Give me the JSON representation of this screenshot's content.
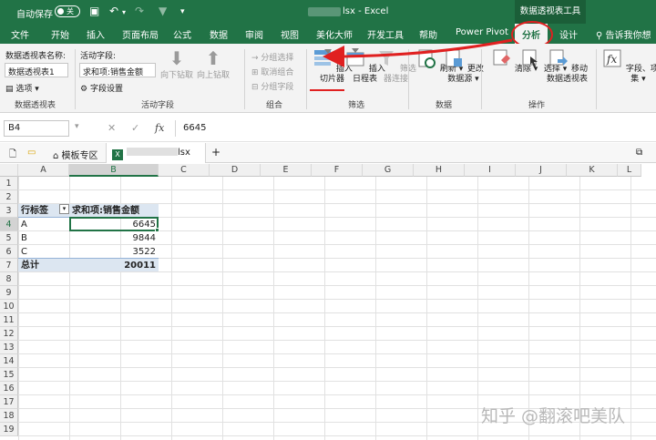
{
  "titlebar": {
    "autosave_label": "自动保存",
    "autosave_state": "关",
    "doc_title": "lsx  -  Excel",
    "context_tool": "数据透视表工具"
  },
  "tabs": [
    "文件",
    "开始",
    "插入",
    "页面布局",
    "公式",
    "数据",
    "审阅",
    "视图",
    "美化大师",
    "开发工具",
    "帮助",
    "Power Pivot",
    "分析",
    "设计"
  ],
  "tell_me": "告诉我你想",
  "ribbon": {
    "pivot_name_label": "数据透视表名称:",
    "pivot_name_value": "数据透视表1",
    "options_label": "选项",
    "active_field_label": "活动字段:",
    "active_field_value": "求和项:销售金额",
    "field_settings_label": "字段设置",
    "drill_down_label": "向下钻取",
    "drill_up_label": "向上钻取",
    "group_selection_label": "分组选择",
    "ungroup_label": "取消组合",
    "group_field_label": "分组字段",
    "insert_slicer_label": [
      "插入",
      "切片器"
    ],
    "insert_timeline_label": [
      "插入",
      "日程表"
    ],
    "filter_connections_label": [
      "筛选",
      "器连接"
    ],
    "refresh_label": "刷新",
    "change_source_label": [
      "更改",
      "数据源"
    ],
    "clear_label": "清除",
    "select_label": "选择",
    "move_pivot_label": [
      "移动",
      "数据透视表"
    ],
    "fields_items_label": [
      "字段、项目和",
      "集"
    ],
    "groups": {
      "pivot": "数据透视表",
      "active_field": "活动字段",
      "group": "组合",
      "filter": "筛选",
      "data": "数据",
      "actions": "操作"
    }
  },
  "formula_bar": {
    "name_box": "B4",
    "fx": "fx",
    "value": "6645"
  },
  "doc_tabs": {
    "template_zone": "模板专区",
    "file_tab": "lsx",
    "add": "+"
  },
  "grid": {
    "columns": [
      "A",
      "B",
      "C",
      "D",
      "E",
      "F",
      "G",
      "H",
      "I",
      "J",
      "K",
      "L"
    ],
    "rows": [
      "1",
      "2",
      "3",
      "4",
      "5",
      "6",
      "7",
      "8",
      "9",
      "10",
      "11",
      "12",
      "13",
      "14",
      "15",
      "16",
      "17",
      "18",
      "19"
    ]
  },
  "pivot": {
    "row_label_header": "行标签",
    "value_header": "求和项:销售金额",
    "rows": [
      {
        "label": "A",
        "value": "6645"
      },
      {
        "label": "B",
        "value": "9844"
      },
      {
        "label": "C",
        "value": "3522"
      }
    ],
    "total_label": "总计",
    "total_value": "20011"
  },
  "watermark": "知乎 @翻滚吧美队",
  "colors": {
    "excel_green": "#217346",
    "annotation_red": "#e02020",
    "pivot_header_fill": "#dce6f1"
  }
}
